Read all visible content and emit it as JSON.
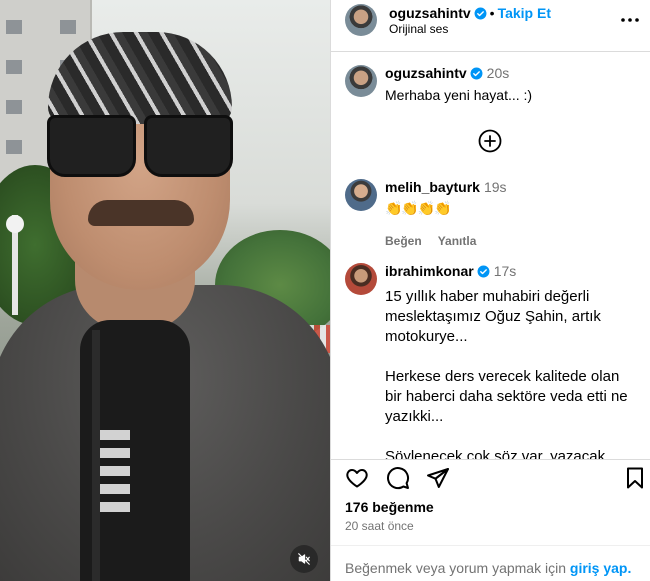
{
  "header": {
    "username": "oguzsahintv",
    "separator": "•",
    "follow_label": "Takip Et",
    "audio_label": "Orijinal ses",
    "more_icon": "more-horizontal-icon"
  },
  "caption": {
    "username": "oguzsahintv",
    "time": "20s",
    "text": "Merhaba yeni hayat... :)"
  },
  "comments": [
    {
      "username": "melih_bayturk",
      "time": "19s",
      "text": "👏👏👏👏",
      "like_label": "Beğen",
      "reply_label": "Yanıtla"
    },
    {
      "username": "ibrahimkonar",
      "time": "17s",
      "verified": true,
      "text": "15 yıllık haber muhabiri değerli meslektaşımız Oğuz Şahin, artık motokurye...\n\nHerkese ders verecek kalitede olan bir haberci daha sektöre veda etti ne yazıkki...\n\nSöylenecek çok söz var, yazacak"
    }
  ],
  "post": {
    "likes": "176 beğenme",
    "time_ago": "20 saat önce"
  },
  "footer": {
    "text": "Beğenmek veya yorum yapmak için",
    "link": "giriş yap."
  },
  "colors": {
    "link_blue": "#0095f6",
    "muted_text": "#737373",
    "border": "#dbdbdb"
  }
}
